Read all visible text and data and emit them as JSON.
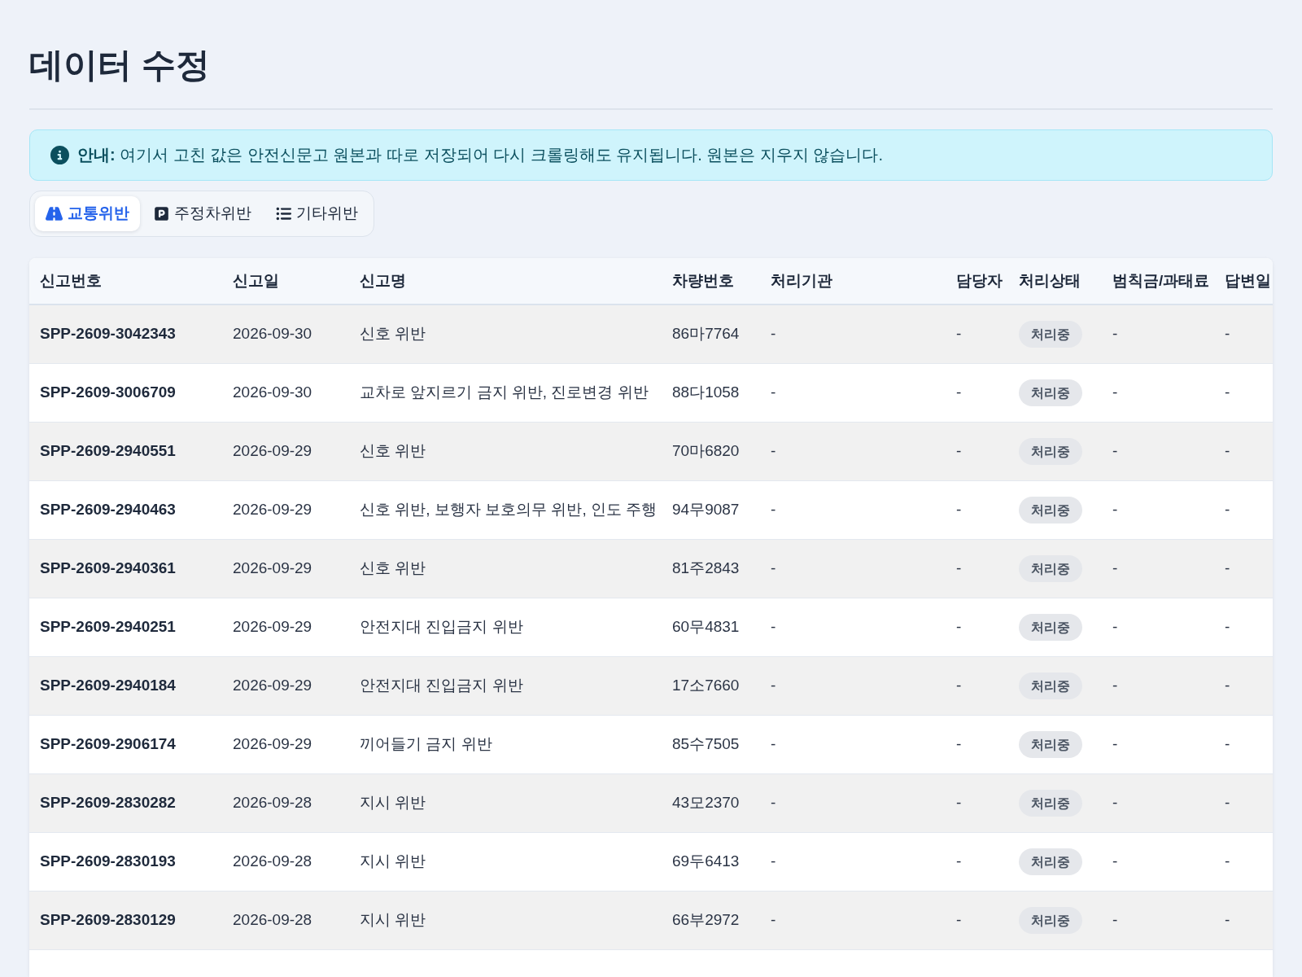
{
  "page": {
    "title": "데이터 수정"
  },
  "notice": {
    "text": "**안내:** 여기서 고친 값은 안전신문고 원본과 따로 저장되어 다시 크롤링해도 유지됩니다. 원본은 지우지 않습니다."
  },
  "tabs": [
    {
      "label": "교통위반",
      "selected": true
    },
    {
      "label": "주정차위반",
      "selected": false
    },
    {
      "label": "기타위반",
      "selected": false
    }
  ],
  "table": {
    "columns": [
      {
        "label": "신고번호",
        "kind": "strong"
      },
      {
        "label": "신고일",
        "kind": "text"
      },
      {
        "label": "신고명",
        "kind": "text"
      },
      {
        "label": "차량번호",
        "kind": "text"
      },
      {
        "label": "처리기관",
        "kind": "text"
      },
      {
        "label": "담당자",
        "kind": "text"
      },
      {
        "label": "처리상태",
        "kind": "badge"
      },
      {
        "label": "범칙금/과태료",
        "kind": "text"
      },
      {
        "label": "답변일",
        "kind": "text"
      }
    ],
    "rows": [
      {
        "cells": [
          "SPP-2609-3042343",
          "2026-09-30",
          "신호 위반",
          "86마7764",
          "-",
          "-",
          "처리중",
          "-",
          "-"
        ]
      },
      {
        "cells": [
          "SPP-2609-3006709",
          "2026-09-30",
          "교차로 앞지르기 금지 위반, 진로변경 위반",
          "88다1058",
          "-",
          "-",
          "처리중",
          "-",
          "-"
        ]
      },
      {
        "cells": [
          "SPP-2609-2940551",
          "2026-09-29",
          "신호 위반",
          "70마6820",
          "-",
          "-",
          "처리중",
          "-",
          "-"
        ]
      },
      {
        "cells": [
          "SPP-2609-2940463",
          "2026-09-29",
          "신호 위반, 보행자 보호의무 위반, 인도 주행",
          "94무9087",
          "-",
          "-",
          "처리중",
          "-",
          "-"
        ]
      },
      {
        "cells": [
          "SPP-2609-2940361",
          "2026-09-29",
          "신호 위반",
          "81주2843",
          "-",
          "-",
          "처리중",
          "-",
          "-"
        ]
      },
      {
        "cells": [
          "SPP-2609-2940251",
          "2026-09-29",
          "안전지대 진입금지 위반",
          "60무4831",
          "-",
          "-",
          "처리중",
          "-",
          "-"
        ]
      },
      {
        "cells": [
          "SPP-2609-2940184",
          "2026-09-29",
          "안전지대 진입금지 위반",
          "17소7660",
          "-",
          "-",
          "처리중",
          "-",
          "-"
        ]
      },
      {
        "cells": [
          "SPP-2609-2906174",
          "2026-09-29",
          "끼어들기 금지 위반",
          "85수7505",
          "-",
          "-",
          "처리중",
          "-",
          "-"
        ]
      },
      {
        "cells": [
          "SPP-2609-2830282",
          "2026-09-28",
          "지시 위반",
          "43모2370",
          "-",
          "-",
          "처리중",
          "-",
          "-"
        ]
      },
      {
        "cells": [
          "SPP-2609-2830193",
          "2026-09-28",
          "지시 위반",
          "69두6413",
          "-",
          "-",
          "처리중",
          "-",
          "-"
        ]
      },
      {
        "cells": [
          "SPP-2609-2830129",
          "2026-09-28",
          "지시 위반",
          "66부2972",
          "-",
          "-",
          "처리중",
          "-",
          "-"
        ]
      }
    ]
  }
}
